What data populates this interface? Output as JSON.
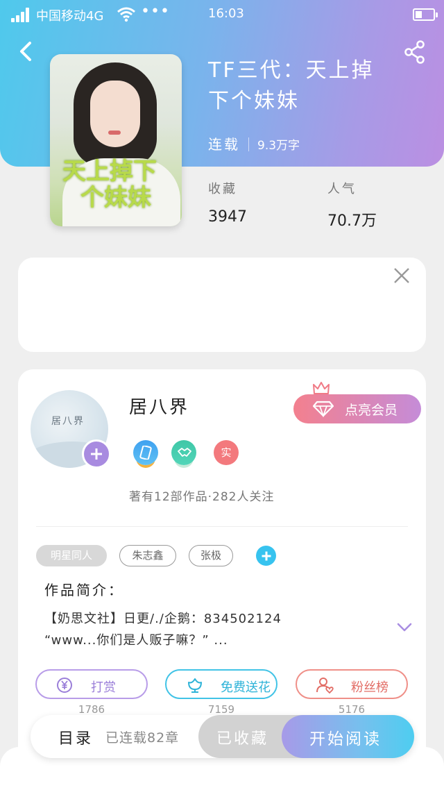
{
  "status_bar": {
    "carrier": "中国移动4G",
    "dots": "•••",
    "time": "16:03"
  },
  "book": {
    "title": "TF三代：天上掉下个妹妹",
    "status": "连载",
    "word_count": "9.3万字",
    "cover_text": [
      "天上掉下",
      "个妹妹"
    ],
    "favorites_label": "收藏",
    "favorites_count": "3947",
    "popularity_label": "人气",
    "popularity_count": "70.7万"
  },
  "author": {
    "name": "居八界",
    "avatar_signature": "居八界",
    "vip_button_label": "点亮会员",
    "badge_real": "实",
    "works_summary": "著有12部作品·282人关注"
  },
  "tags": [
    "明星同人",
    "朱志鑫",
    "张极"
  ],
  "intro": {
    "label": "作品简介：",
    "line1": "【奶思文社】日更/./企鹅：834502124",
    "line2": "“www...你们是人贩子嘛？” ..."
  },
  "actions": [
    {
      "label": "打赏",
      "count": "1786"
    },
    {
      "label": "免费送花",
      "count": "7159"
    },
    {
      "label": "粉丝榜",
      "count": "5176"
    }
  ],
  "bottom_bar": {
    "toc_label": "目录",
    "toc_count": "已连载82章",
    "collected_label": "已收藏",
    "read_label": "开始阅读"
  },
  "colors": {
    "header_gradient": [
      "#4fc9ec",
      "#bb8fe2"
    ],
    "vip_gradient": [
      "#f3808e",
      "#c58cd8"
    ],
    "accent_purple": "#9b7fd9",
    "accent_cyan": "#2eb3d8",
    "accent_red": "#e26d66"
  }
}
